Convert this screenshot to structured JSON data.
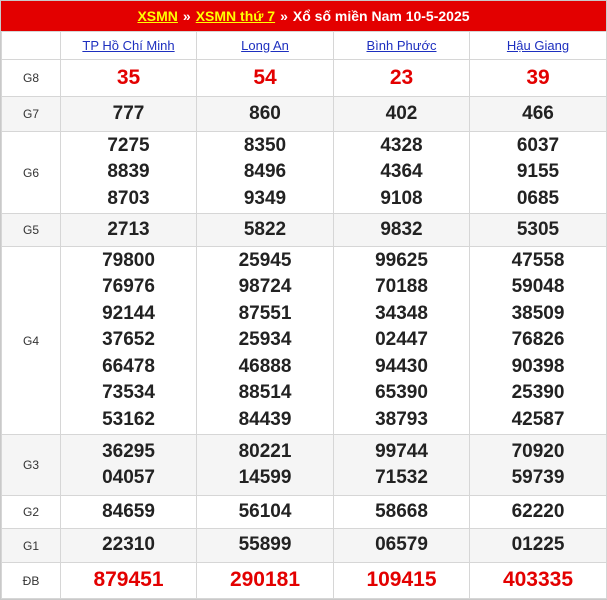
{
  "breadcrumb": {
    "link1": "XSMN",
    "link2": "XSMN thứ 7",
    "sep": "»",
    "title": "Xổ số miền Nam 10-5-2025"
  },
  "provinces": [
    "TP Hồ Chí Minh",
    "Long An",
    "Bình Phước",
    "Hậu Giang"
  ],
  "prizes": [
    {
      "label": "G8",
      "red": true,
      "values": [
        [
          "35"
        ],
        [
          "54"
        ],
        [
          "23"
        ],
        [
          "39"
        ]
      ]
    },
    {
      "label": "G7",
      "values": [
        [
          "777"
        ],
        [
          "860"
        ],
        [
          "402"
        ],
        [
          "466"
        ]
      ]
    },
    {
      "label": "G6",
      "values": [
        [
          "7275",
          "8839",
          "8703"
        ],
        [
          "8350",
          "8496",
          "9349"
        ],
        [
          "4328",
          "4364",
          "9108"
        ],
        [
          "6037",
          "9155",
          "0685"
        ]
      ]
    },
    {
      "label": "G5",
      "values": [
        [
          "2713"
        ],
        [
          "5822"
        ],
        [
          "9832"
        ],
        [
          "5305"
        ]
      ]
    },
    {
      "label": "G4",
      "values": [
        [
          "79800",
          "76976",
          "92144",
          "37652",
          "66478",
          "73534",
          "53162"
        ],
        [
          "25945",
          "98724",
          "87551",
          "25934",
          "46888",
          "88514",
          "84439"
        ],
        [
          "99625",
          "70188",
          "34348",
          "02447",
          "94430",
          "65390",
          "38793"
        ],
        [
          "47558",
          "59048",
          "38509",
          "76826",
          "90398",
          "25390",
          "42587"
        ]
      ]
    },
    {
      "label": "G3",
      "values": [
        [
          "36295",
          "04057"
        ],
        [
          "80221",
          "14599"
        ],
        [
          "99744",
          "71532"
        ],
        [
          "70920",
          "59739"
        ]
      ]
    },
    {
      "label": "G2",
      "values": [
        [
          "84659"
        ],
        [
          "56104"
        ],
        [
          "58668"
        ],
        [
          "62220"
        ]
      ]
    },
    {
      "label": "G1",
      "values": [
        [
          "22310"
        ],
        [
          "55899"
        ],
        [
          "06579"
        ],
        [
          "01225"
        ]
      ]
    },
    {
      "label": "ĐB",
      "red": true,
      "values": [
        [
          "879451"
        ],
        [
          "290181"
        ],
        [
          "109415"
        ],
        [
          "403335"
        ]
      ]
    }
  ],
  "colors": {
    "accent": "#e30000",
    "link": "#1d2fbf",
    "highlight": "#ffff00"
  }
}
